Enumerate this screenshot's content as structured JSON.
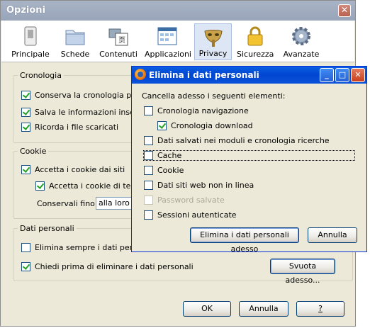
{
  "main_window": {
    "title": "Opzioni",
    "close_glyph": "✕",
    "toolbar": [
      {
        "label": "Principale",
        "icon": "switch-icon"
      },
      {
        "label": "Schede",
        "icon": "folder-icon"
      },
      {
        "label": "Contenuti",
        "icon": "content-icon"
      },
      {
        "label": "Applicazioni",
        "icon": "applications-icon"
      },
      {
        "label": "Privacy",
        "icon": "mask-icon",
        "selected": true
      },
      {
        "label": "Sicurezza",
        "icon": "lock-icon"
      },
      {
        "label": "Avanzate",
        "icon": "gear-icon"
      }
    ],
    "history": {
      "legend": "Cronologia",
      "items": [
        {
          "label": "Conserva la cronologia per a",
          "checked": true
        },
        {
          "label": "Salva le informazioni inserite",
          "checked": true
        },
        {
          "label": "Ricorda i file scaricati",
          "checked": true
        }
      ]
    },
    "cookies": {
      "legend": "Cookie",
      "accept": {
        "label": "Accetta i cookie dai siti",
        "checked": true
      },
      "third_party": {
        "label": "Accetta i cookie di terze",
        "checked": true
      },
      "keep_label": "Conservali fino:",
      "keep_value": "alla loro s"
    },
    "personal_data": {
      "legend": "Dati personali",
      "always_clear": {
        "label": "Elimina sempre i dati persona",
        "checked": false
      },
      "ask_before": {
        "label": "Chiedi prima di eliminare i dati personali",
        "checked": true
      },
      "clear_now_button": "Svuota adesso..."
    },
    "buttons": {
      "ok": "OK",
      "cancel": "Annulla",
      "help": "?"
    }
  },
  "dialog": {
    "title": "Elimina i dati personali",
    "controls": {
      "minimize": "_",
      "maximize": "□",
      "close": "✕"
    },
    "intro": "Cancella adesso i seguenti elementi:",
    "items": [
      {
        "label": "Cronologia navigazione",
        "checked": false
      },
      {
        "label": "Cronologia download",
        "checked": true
      },
      {
        "label": "Dati salvati nei moduli e cronologia ricerche",
        "checked": false
      },
      {
        "label": "Cache",
        "checked": false
      },
      {
        "label": "Cookie",
        "checked": false
      },
      {
        "label": "Dati siti web non in linea",
        "checked": false
      },
      {
        "label": "Password salvate",
        "checked": false,
        "disabled": true
      },
      {
        "label": "Sessioni autenticate",
        "checked": false
      }
    ],
    "buttons": {
      "clear": "Elimina i dati personali adesso",
      "cancel": "Annulla"
    }
  }
}
